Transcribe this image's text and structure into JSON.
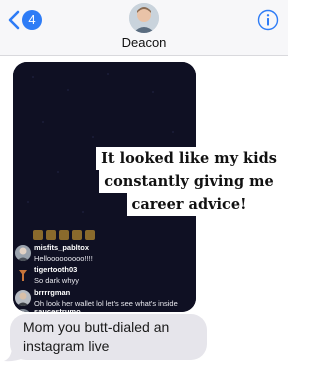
{
  "header": {
    "back_badge": "4",
    "contact_name": "Deacon",
    "back_icon": "chevron-left-icon",
    "info_icon": "info-icon",
    "accent_color": "#2e7cf6"
  },
  "live_screenshot": {
    "caption_lines": [
      "It looked like my kids",
      "constantly giving me",
      "career advice!"
    ],
    "comments": [
      {
        "username": "misfits_pabltox",
        "text": "Hellooooooooo!!!!"
      },
      {
        "username": "tigertooth03",
        "text": "So dark whyy"
      },
      {
        "username": "brrrrgman",
        "text": "Oh look her wallet lol let's see what's inside"
      },
      {
        "username": "saucestrumo",
        "text": ""
      }
    ]
  },
  "message": {
    "text": "Mom you butt-dialed an instagram live"
  }
}
